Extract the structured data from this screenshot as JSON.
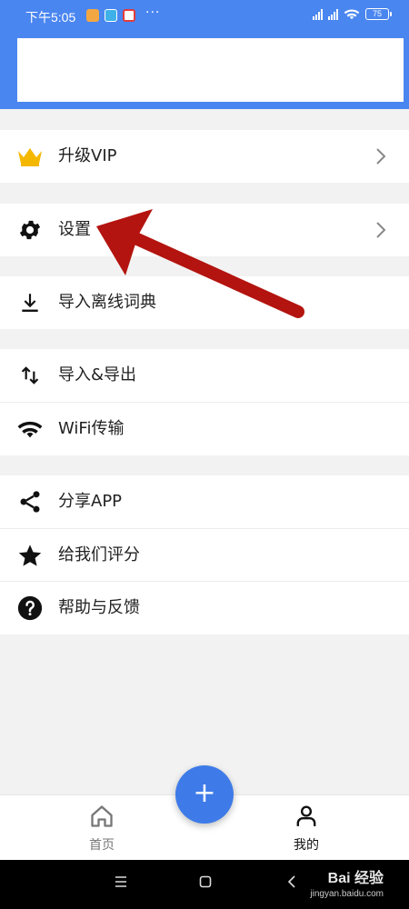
{
  "status_bar": {
    "time": "下午5:05",
    "more": "···",
    "battery": "75",
    "notification_icons": [
      "orange-app-icon",
      "blue-app-icon",
      "red-app-icon"
    ],
    "indicator_icons": [
      "signal-icon",
      "signal-icon",
      "wifi-icon",
      "battery-icon"
    ]
  },
  "menu": {
    "items": [
      {
        "label": "升级VIP",
        "icon": "crown-icon",
        "has_chevron": true
      },
      {
        "label": "设置",
        "icon": "gear-icon",
        "has_chevron": true
      },
      {
        "label": "导入离线词典",
        "icon": "download-icon",
        "has_chevron": false
      },
      {
        "label": "导入&导出",
        "icon": "import-export-icon",
        "has_chevron": false
      },
      {
        "label": "WiFi传输",
        "icon": "wifi-icon",
        "has_chevron": false
      },
      {
        "label": "分享APP",
        "icon": "share-icon",
        "has_chevron": false
      },
      {
        "label": "给我们评分",
        "icon": "star-icon",
        "has_chevron": false
      },
      {
        "label": "帮助与反馈",
        "icon": "help-icon",
        "has_chevron": false
      }
    ]
  },
  "bottom_nav": {
    "home_label": "首页",
    "fab_label": "+",
    "mine_label": "我的"
  },
  "watermark": {
    "brand": "Bai 经验",
    "url": "jingyan.baidu.com"
  },
  "colors": {
    "header": "#4a86f0",
    "fab": "#3f7be8",
    "crown": "#f5b800",
    "annotation_arrow": "#b3140f"
  }
}
